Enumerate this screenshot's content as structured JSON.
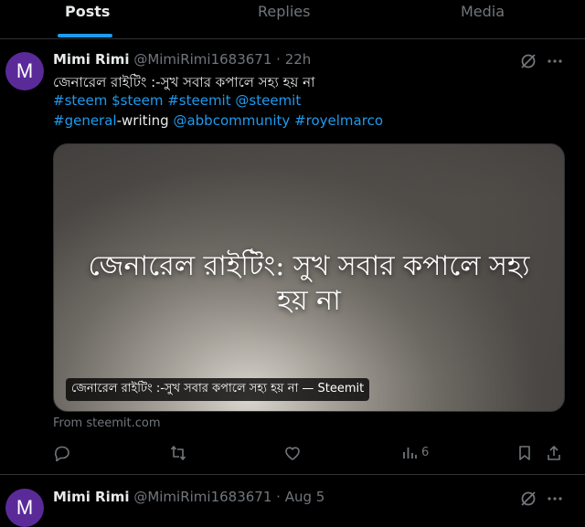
{
  "tabs": [
    {
      "label": "Posts",
      "active": true
    },
    {
      "label": "Replies",
      "active": false
    },
    {
      "label": "Media",
      "active": false
    }
  ],
  "tweet1": {
    "avatar_letter": "M",
    "name": "Mimi Rimi",
    "handle": "@MimiRimi1683671",
    "dot": "·",
    "time": "22h",
    "text_line1": "জেনারেল রাইটিং :-সুখ সবার কপালে সহ্য হয় না",
    "hashtags_line2": [
      "#steem",
      "$steem",
      "#steemit",
      "@steemit"
    ],
    "line3": {
      "tag1": "#general",
      "plain": "-writing",
      "mention": "@abbcommunity",
      "tag2": "#royelmarco"
    },
    "card": {
      "headline": "জেনারেল রাইটিং: সুখ সবার কপালে সহ্য হয় না",
      "label": "জেনারেল রাইটিং :-সুখ সবার কপালে সহ্য হয় না — Steemit"
    },
    "source": "From steemit.com",
    "views": "6"
  },
  "tweet2": {
    "avatar_letter": "M",
    "name": "Mimi Rimi",
    "handle": "@MimiRimi1683671",
    "dot": "·",
    "time": "Aug 5"
  },
  "colors": {
    "accent": "#1d9bf0",
    "muted": "#71767b",
    "text": "#e7e9ea",
    "avatar": "#5b2a99"
  },
  "icons": [
    "grok-slash-icon",
    "more-icon",
    "reply-icon",
    "retweet-icon",
    "like-icon",
    "views-icon",
    "bookmark-icon",
    "share-icon"
  ]
}
